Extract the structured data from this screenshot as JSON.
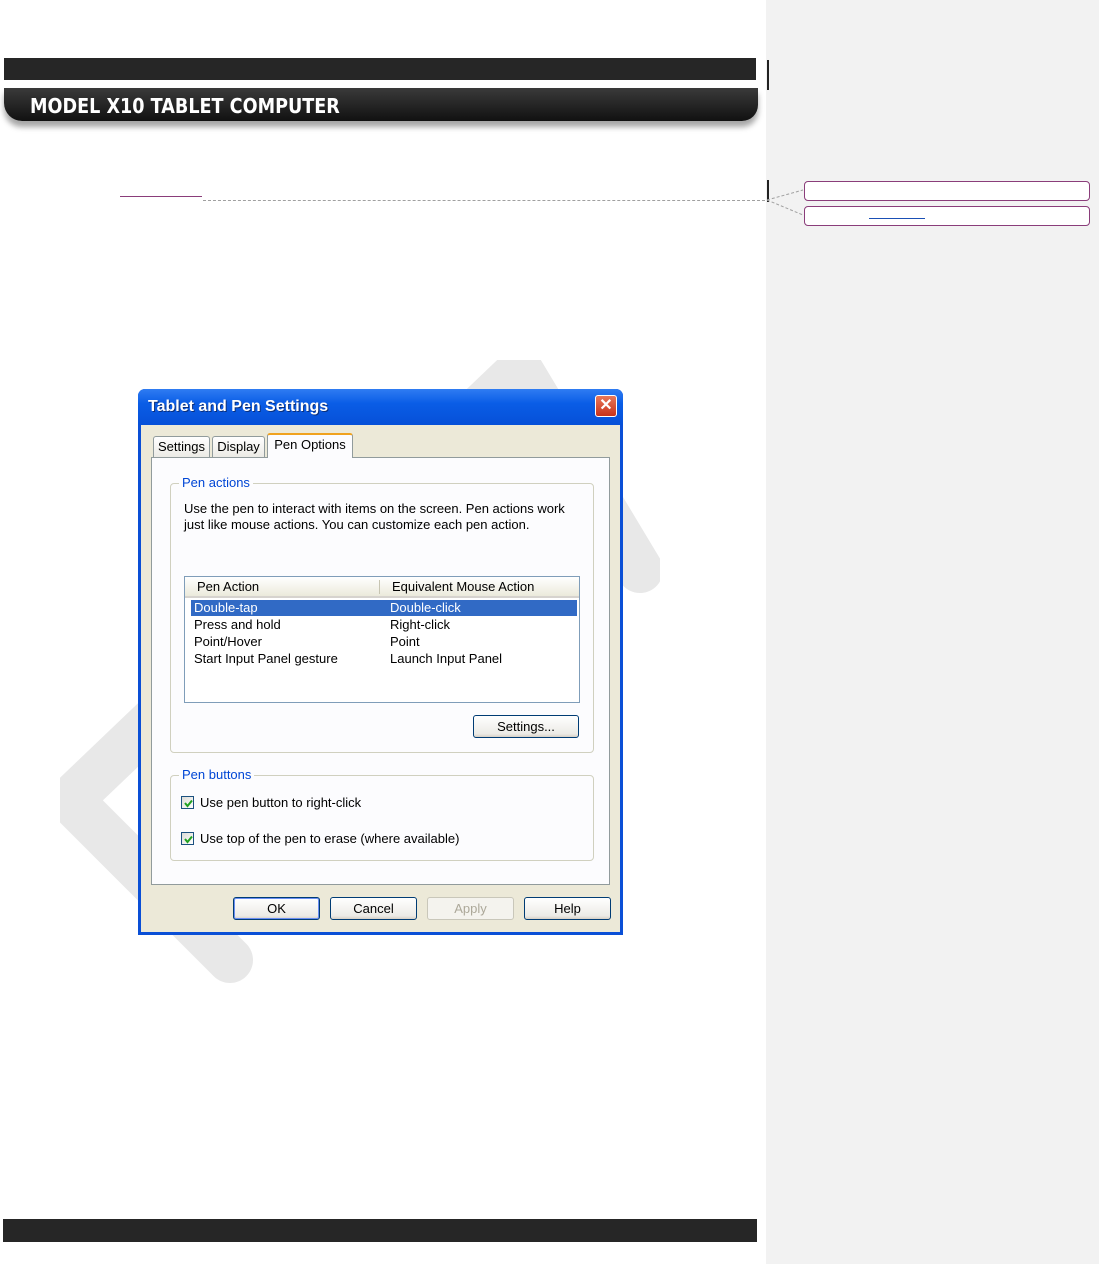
{
  "document": {
    "banner_title": "MODEL X10 TABLET COMPUTER"
  },
  "dialog": {
    "title": "Tablet and Pen Settings",
    "close_glyph": "✕",
    "tabs": [
      {
        "label": "Settings",
        "active": false
      },
      {
        "label": "Display",
        "active": false
      },
      {
        "label": "Pen Options",
        "active": true
      }
    ],
    "pen_actions": {
      "group_label": "Pen actions",
      "description": "Use the pen to interact with items on the screen. Pen actions work just like mouse actions. You can customize each pen action.",
      "columns": [
        "Pen Action",
        "Equivalent Mouse Action"
      ],
      "rows": [
        {
          "action": "Double-tap",
          "mouse": "Double-click",
          "selected": true
        },
        {
          "action": "Press and hold",
          "mouse": "Right-click",
          "selected": false
        },
        {
          "action": "Point/Hover",
          "mouse": "Point",
          "selected": false
        },
        {
          "action": "Start Input Panel gesture",
          "mouse": "Launch Input Panel",
          "selected": false
        }
      ],
      "settings_button": "Settings..."
    },
    "pen_buttons": {
      "group_label": "Pen buttons",
      "options": [
        {
          "label": "Use pen button to right-click",
          "checked": true
        },
        {
          "label": "Use top of the pen to erase (where available)",
          "checked": true
        }
      ]
    },
    "buttons": {
      "ok": "OK",
      "cancel": "Cancel",
      "apply": "Apply",
      "help": "Help"
    }
  },
  "colors": {
    "titlebar": "#0a5de6",
    "group_label": "#0046d5",
    "selection": "#316ac5",
    "comment_border": "#8a3d7a",
    "banner": "#262626"
  }
}
